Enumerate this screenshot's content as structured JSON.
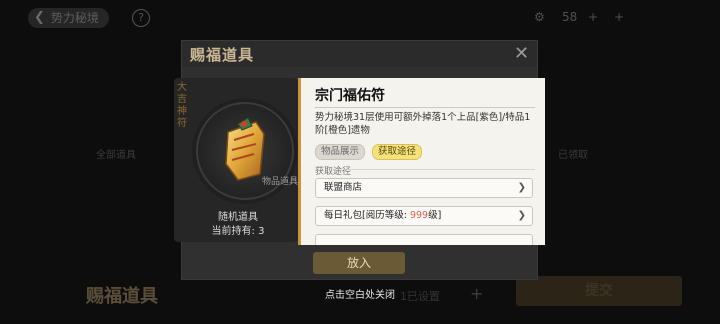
{
  "topbar": {
    "back_label": "势力秘境",
    "help_label": "?",
    "res1": "58",
    "res2": "+",
    "res3": "+"
  },
  "background": {
    "bottom_title": "赐福道具",
    "side_left": "全部道具",
    "side_right": "已领取",
    "pill": "1已设置",
    "plus": "+",
    "right_button": "提交"
  },
  "modal": {
    "title": "赐福道具",
    "close_icon": "✕",
    "vertical_text": "大吉神符",
    "stamp_text": "物品道具",
    "item_type": "随机道具",
    "holding": "当前持有: 3",
    "confirm_label": "放入"
  },
  "tooltip": {
    "title": "宗门福佑符",
    "description": "势力秘境31层使用可额外掉落1个上品[紫色]/特品1阶[橙色]遗物",
    "tabs": [
      "物品展示",
      "获取途径"
    ],
    "section_label": "获取途径",
    "sources": [
      {
        "label": "联盟商店"
      },
      {
        "label_prefix": "每日礼包[阅历等级: ",
        "label_value": "999",
        "label_suffix": "级]"
      }
    ]
  },
  "bottom_hint": "点击空白处关闭",
  "colors": {
    "accent_gold": "#c9953c",
    "tab_active": "#f6e27a",
    "highlight_red": "#e15a4e"
  }
}
